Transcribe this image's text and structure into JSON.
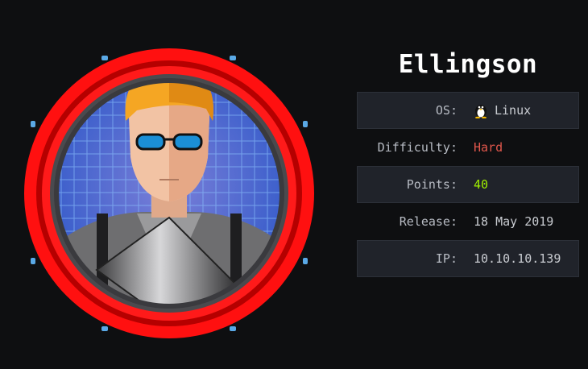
{
  "machine": {
    "name": "Ellingson"
  },
  "stats": [
    {
      "key": "os",
      "label": "OS:",
      "value": "Linux",
      "icon": "tux-penguin-icon",
      "color": "#c9ccd1"
    },
    {
      "key": "difficulty",
      "label": "Difficulty:",
      "value": "Hard",
      "color": "#e2574c"
    },
    {
      "key": "points",
      "label": "Points:",
      "value": "40",
      "color": "#9fef00"
    },
    {
      "key": "release",
      "label": "Release:",
      "value": "18 May 2019",
      "color": "#c9ccd1"
    },
    {
      "key": "ip",
      "label": "IP:",
      "value": "10.10.10.139",
      "color": "#c9ccd1"
    }
  ],
  "theme": {
    "background": "#0e0f11",
    "ring": "#ff0a0a",
    "grid": "#3a6bd8"
  }
}
